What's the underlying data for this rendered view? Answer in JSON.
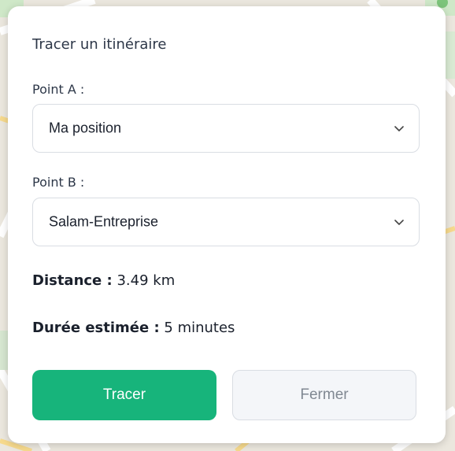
{
  "colors": {
    "primary": "#17b47b",
    "map_background": "#e9e5dc"
  },
  "dialog": {
    "title": "Tracer un itinéraire",
    "point_a": {
      "label": "Point A :",
      "selected": "Ma position",
      "icon": "chevron-down-icon"
    },
    "point_b": {
      "label": "Point B :",
      "selected": "Salam-Entreprise",
      "icon": "chevron-down-icon"
    },
    "distance": {
      "label": "Distance :",
      "value": "3.49 km"
    },
    "duration": {
      "label": "Durée estimée :",
      "value": "5 minutes"
    },
    "buttons": {
      "trace": "Tracer",
      "close": "Fermer"
    }
  }
}
